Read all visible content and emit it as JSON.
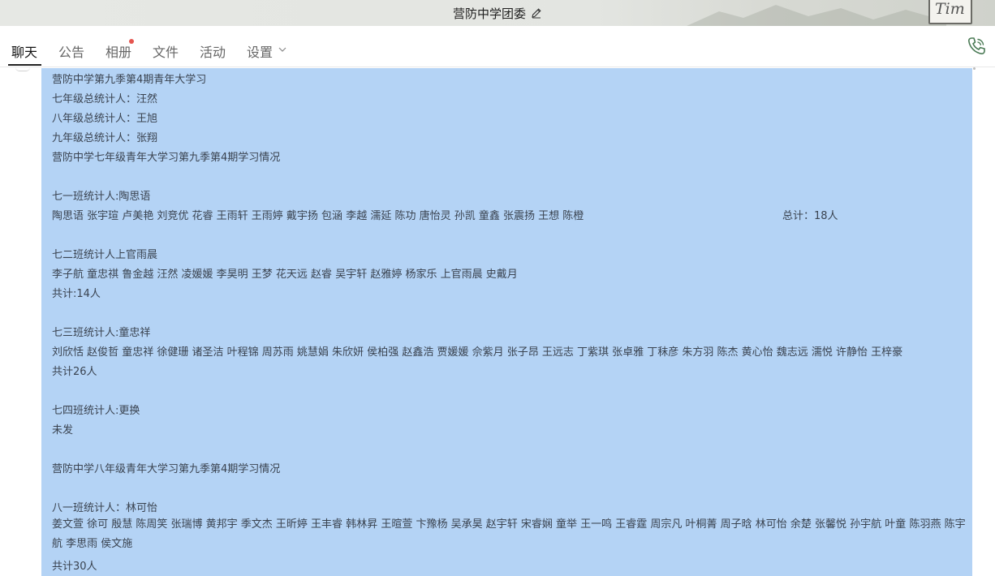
{
  "window": {
    "title": "营防中学团委",
    "seal_text": "Tim"
  },
  "tabs": [
    {
      "label": "聊天",
      "active": true
    },
    {
      "label": "公告",
      "active": false
    },
    {
      "label": "相册",
      "active": false,
      "has_badge": true
    },
    {
      "label": "文件",
      "active": false
    },
    {
      "label": "活动",
      "active": false
    },
    {
      "label": "设置",
      "active": false,
      "has_dropdown": true
    }
  ],
  "icons": {
    "edit": "pencil-icon",
    "phone": "phone-icon",
    "dropdown": "chevron-down-icon"
  },
  "colors": {
    "bubble": "#b4d3f5",
    "badge": "#e5554f",
    "phone": "#4a7a55"
  },
  "message": {
    "lines": [
      "营防中学第九季第4期青年大学习",
      "七年级总统计人：汪然",
      " 八年级总统计人：王旭",
      " 九年级总统计人：张翔",
      "营防中学七年级青年大学习第九季第4期学习情况",
      "",
      "七一班统计人:陶思语",
      "陶思语 张宇瑄 卢美艳 刘竞优 花睿 王雨轩 王雨婷 戴宇扬 包涵 李越 濡延 陈功 唐怡灵 孙凯 童鑫 张震扬 王想 陈橙",
      "",
      "七二班统计人上官雨晨",
      "李子航 童忠祺 鲁金越 汪然 凌媛媛 李昊明 王梦 花天远 赵睿 吴宇轩 赵雅婷 杨家乐 上官雨晨 史戴月",
      "共计:14人",
      "",
      "七三班统计人:童忠祥",
      "刘欣恬 赵俊哲 童忠祥 徐健珊 诸圣洁 叶程锦 周苏雨 姚慧娟 朱欣妍 侯柏强 赵鑫浩 贾媛媛 佘紫月 张子昂 王远志 丁紫琪 张卓雅 丁秣彦 朱方羽 陈杰 黄心怡 魏志远 濡悦 许静怡 王梓豪",
      "共计26人",
      "",
      "七四班统计人:更换",
      "未发",
      "",
      "营防中学八年级青年大学习第九季第4期学习情况",
      "",
      "八一班统计人：林可怡",
      "姜文萱 徐可 殷慧 陈周笑 张瑞博 黄邦宇 季文杰 王昕婷 王丰睿 韩林昇 王暄萱 卞豫杨 吴承昊 赵宇轩 宋睿娴 童举 王一鸣 王睿霆 周宗凡 叶桐菁 周子晗 林可怡 余楚 张馨悦 孙宇航 叶童 陈羽燕 陈宇航 李思雨 侯文施",
      "共计30人"
    ],
    "total_right": "总计：18人"
  }
}
